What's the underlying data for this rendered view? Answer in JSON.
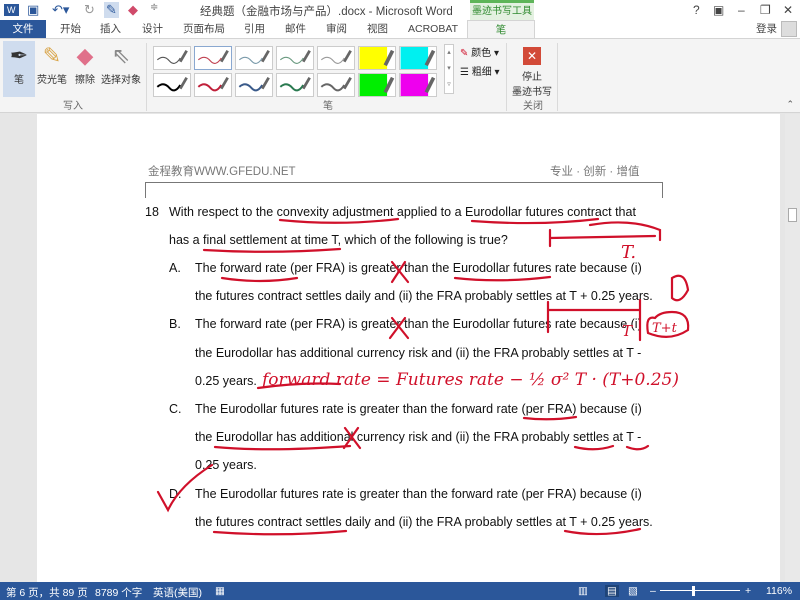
{
  "window": {
    "title": "经典题（金融市场与产品）.docx - Microsoft Word",
    "context_tab": "墨迹书写工具",
    "help": "?",
    "signin": "登录"
  },
  "tabs": [
    "文件",
    "开始",
    "插入",
    "设计",
    "页面布局",
    "引用",
    "邮件",
    "审阅",
    "视图",
    "ACROBAT",
    "笔"
  ],
  "ribbon": {
    "write_tools": [
      {
        "label": "笔"
      },
      {
        "label": "荧光笔"
      },
      {
        "label": "擦除"
      },
      {
        "label": "选择对象"
      }
    ],
    "write_group": "写入",
    "pens_group": "笔",
    "color_label": "颜色",
    "thickness_label": "粗细",
    "stop_label_1": "停止",
    "stop_label_2": "墨迹书写",
    "close_group": "关闭",
    "pens_row1": [
      "#555555",
      "#c04050",
      "#7a9aaa",
      "#6a9a80",
      "#9a9a9a",
      "#ffff00",
      "#00f0f0"
    ],
    "pens_row2": [
      "#000000",
      "#c0203a",
      "#3a5a8a",
      "#2a7a50",
      "#666666",
      "#00ee00",
      "#ee00ee"
    ]
  },
  "document": {
    "header_left": "金程教育WWW.GFEDU.NET",
    "header_right": "专业 · 创新 · 增值",
    "question_number": "18",
    "lines": [
      "With respect to the convexity adjustment applied to a Eurodollar futures contract that",
      "has a final settlement at time T, which of the following is true?"
    ],
    "options": [
      {
        "letter": "A.",
        "lines": [
          "The forward rate (per FRA) is greater than the Eurodollar futures rate because (i)",
          "the futures contract settles daily and (ii) the FRA probably settles at T + 0.25 years."
        ]
      },
      {
        "letter": "B.",
        "lines": [
          "The forward rate (per FRA) is greater than the Eurodollar futures rate because (i)",
          "the Eurodollar has additional currency risk and (ii) the FRA probably settles at T -",
          "0.25 years."
        ]
      },
      {
        "letter": "C.",
        "lines": [
          "The Eurodollar futures rate is greater than the forward rate (per FRA) because (i)",
          "the Eurodollar has additional currency risk and (ii) the FRA probably settles at T -",
          "0.25 years."
        ]
      },
      {
        "letter": "D.",
        "lines": [
          "The Eurodollar futures rate is greater than the forward rate (per FRA) because (i)",
          "the futures contract settles daily and (ii) the FRA probably settles at T + 0.25 years."
        ]
      }
    ],
    "ink": {
      "formula": "forward rate = Futures rate − ½ σ² T · (T+0.25)",
      "t_label": "T.",
      "t_label2": "T",
      "t_plus": "T+t"
    }
  },
  "status": {
    "page": "第 6 页，共 89 页",
    "words": "8789 个字",
    "language": "英语(美国)",
    "zoom": "116%"
  },
  "colors": {
    "accent": "#2b579a",
    "ink": "#d0102a",
    "ink_tab": "#2f8a2f"
  }
}
